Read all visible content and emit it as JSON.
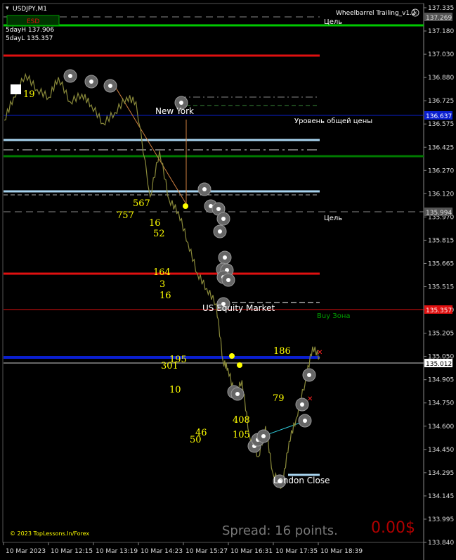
{
  "window": {
    "symbol_timeframe": "USDJPY,M1",
    "indicator_title": "Wheelbarrel Trailing_v1.2",
    "esd_badge": "ESD",
    "five_day_high": "5dayH 137.906",
    "five_day_low": "5dayL 135.357",
    "copyright": "© 2023 TopLessons.In/Forex",
    "spread_text": "Spread: 16 points.",
    "profit_text": "0.00$"
  },
  "colors": {
    "background": "#000000",
    "price_line": "#8a8a3a",
    "target_green": "#00c800",
    "red_level": "#e01010",
    "blue_level": "#0a1fd0",
    "light_blue": "#a8d4f0",
    "buy_zone": "#00a000",
    "yellow_numbers": "#ffff00",
    "current_price_bg": "#ffffff",
    "profit_red": "#b00000"
  },
  "price_axis": {
    "ticks": [
      "137.335",
      "137.180",
      "137.030",
      "136.880",
      "136.725",
      "136.575",
      "136.425",
      "136.270",
      "136.120",
      "135.970",
      "135.815",
      "135.665",
      "135.515",
      "135.360",
      "135.205",
      "135.050",
      "134.905",
      "134.750",
      "134.600",
      "134.450",
      "134.295",
      "134.145",
      "133.995",
      "133.840"
    ],
    "tagged_prices": [
      {
        "label": "137.269",
        "style": "grey"
      },
      {
        "label": "136.637",
        "style": "blue"
      },
      {
        "label": "135.994",
        "style": "grey"
      },
      {
        "label": "135.357",
        "style": "red"
      },
      {
        "label": "135.012",
        "style": "white"
      }
    ]
  },
  "time_axis": {
    "ticks": [
      "10 Mar 2023",
      "10 Mar 12:15",
      "10 Mar 13:19",
      "10 Mar 14:23",
      "10 Mar 15:27",
      "10 Mar 16:31",
      "10 Mar 17:35",
      "10 Mar 18:39"
    ]
  },
  "level_labels": {
    "target_top": "Цель",
    "general_price_level": "Уровень общей цены",
    "target_mid": "Цель",
    "buy_zone": "Buy Зона"
  },
  "session_labels": {
    "new_york": "New York",
    "us_equity": "US Equity Market",
    "london_close": "London Close"
  },
  "chart_numbers": [
    "19",
    "567",
    "757",
    "16",
    "52",
    "164",
    "3",
    "16",
    "195",
    "301",
    "186",
    "10",
    "79",
    "408",
    "105",
    "46",
    "50"
  ],
  "chart_data": {
    "type": "line",
    "title": "USDJPY,M1",
    "x_labels": [
      "10 Mar 2023",
      "10 Mar 12:15",
      "10 Mar 13:19",
      "10 Mar 14:23",
      "10 Mar 15:27",
      "10 Mar 16:31",
      "10 Mar 17:35",
      "10 Mar 18:39"
    ],
    "ylim": [
      133.84,
      137.335
    ],
    "series": [
      {
        "values": [
          [
            0,
            136.6
          ],
          [
            4,
            136.75
          ],
          [
            9,
            136.9
          ],
          [
            14,
            136.8
          ],
          [
            19,
            136.75
          ],
          [
            23,
            136.88
          ],
          [
            28,
            136.72
          ],
          [
            33,
            136.77
          ],
          [
            37,
            136.7
          ],
          [
            42,
            136.58
          ],
          [
            47,
            136.65
          ],
          [
            52,
            136.75
          ],
          [
            56,
            136.72
          ],
          [
            62,
            136.1
          ],
          [
            66,
            136.4
          ],
          [
            70,
            136.08
          ],
          [
            74,
            136.0
          ],
          [
            78,
            135.8
          ],
          [
            82,
            135.6
          ],
          [
            86,
            135.5
          ],
          [
            90,
            135.4
          ],
          [
            93,
            135.02
          ],
          [
            95,
            134.98
          ],
          [
            98,
            134.8
          ],
          [
            101,
            134.9
          ],
          [
            104,
            134.55
          ],
          [
            108,
            134.4
          ],
          [
            111,
            134.6
          ],
          [
            114,
            134.3
          ],
          [
            118,
            134.2
          ],
          [
            121,
            134.5
          ],
          [
            124,
            134.65
          ],
          [
            128,
            134.9
          ],
          [
            131,
            135.12
          ],
          [
            134,
            135.05
          ]
        ]
      }
    ],
    "levels": [
      {
        "price": 137.27,
        "kind": "target",
        "color": "green"
      },
      {
        "price": 137.03,
        "kind": "resistance",
        "color": "red"
      },
      {
        "price": 136.637,
        "kind": "general_price",
        "color": "blue"
      },
      {
        "price": 136.47,
        "kind": "level",
        "color": "light_blue"
      },
      {
        "price": 136.37,
        "kind": "level",
        "color": "dark_green"
      },
      {
        "price": 136.12,
        "kind": "level",
        "color": "light_blue"
      },
      {
        "price": 135.994,
        "kind": "target",
        "color": "grey"
      },
      {
        "price": 135.6,
        "kind": "resistance",
        "color": "red"
      },
      {
        "price": 135.357,
        "kind": "level",
        "color": "red"
      },
      {
        "price": 135.06,
        "kind": "support",
        "color": "blue"
      },
      {
        "price": 135.012,
        "kind": "current",
        "color": "white"
      }
    ]
  }
}
